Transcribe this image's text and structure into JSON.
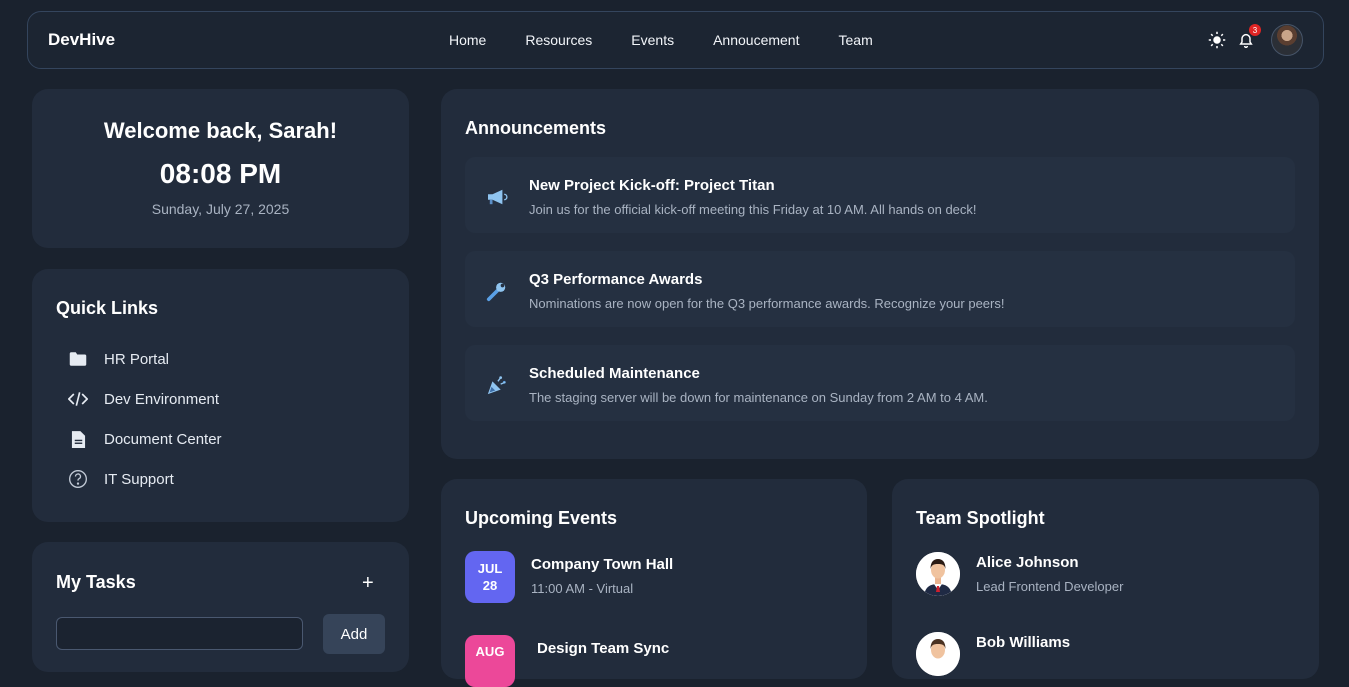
{
  "nav": {
    "brand": "DevHive",
    "links": [
      "Home",
      "Resources",
      "Events",
      "Annoucement",
      "Team"
    ],
    "notification_count": "3"
  },
  "welcome": {
    "greeting": "Welcome back, Sarah!",
    "time": "08:08 PM",
    "date": "Sunday, July 27, 2025"
  },
  "quick_links": {
    "title": "Quick Links",
    "items": [
      {
        "label": "HR Portal",
        "icon": "folder-icon"
      },
      {
        "label": "Dev Environment",
        "icon": "code-icon"
      },
      {
        "label": "Document Center",
        "icon": "document-icon"
      },
      {
        "label": "IT Support",
        "icon": "question-icon"
      }
    ]
  },
  "tasks": {
    "title": "My Tasks",
    "add_icon": "+",
    "input_value": "",
    "add_label": "Add"
  },
  "announcements": {
    "title": "Announcements",
    "items": [
      {
        "title": "New Project Kick-off: Project Titan",
        "desc": "Join us for the official kick-off meeting this Friday at 10 AM. All hands on deck!",
        "icon": "megaphone-icon"
      },
      {
        "title": "Q3 Performance Awards",
        "desc": "Nominations are now open for the Q3 performance awards. Recognize your peers!",
        "icon": "wrench-icon"
      },
      {
        "title": "Scheduled Maintenance",
        "desc": "The staging server will be down for maintenance on Sunday from 2 AM to 4 AM.",
        "icon": "party-popper-icon"
      }
    ]
  },
  "events": {
    "title": "Upcoming Events",
    "items": [
      {
        "month": "JUL",
        "day": "28",
        "title": "Company Town Hall",
        "sub": "11:00 AM - Virtual",
        "color": "#6366f1"
      },
      {
        "month": "AUG",
        "day": "",
        "title": "Design Team Sync",
        "sub": "",
        "color": "#ec4899"
      }
    ]
  },
  "spotlight": {
    "title": "Team Spotlight",
    "members": [
      {
        "name": "Alice Johnson",
        "role": "Lead Frontend Developer"
      },
      {
        "name": "Bob Williams",
        "role": ""
      }
    ]
  }
}
